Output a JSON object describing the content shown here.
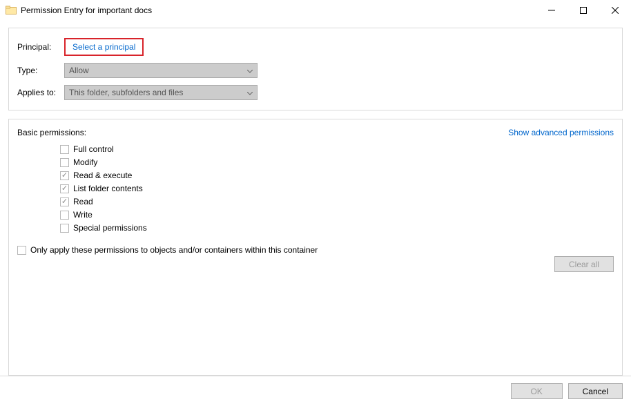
{
  "window": {
    "title": "Permission Entry for important docs"
  },
  "principal": {
    "label": "Principal:",
    "link_text": "Select a principal"
  },
  "type": {
    "label": "Type:",
    "value": "Allow"
  },
  "applies_to": {
    "label": "Applies to:",
    "value": "This folder, subfolders and files"
  },
  "permissions": {
    "title": "Basic permissions:",
    "advanced_link": "Show advanced permissions",
    "items": [
      {
        "label": "Full control",
        "checked": false
      },
      {
        "label": "Modify",
        "checked": false
      },
      {
        "label": "Read & execute",
        "checked": true
      },
      {
        "label": "List folder contents",
        "checked": true
      },
      {
        "label": "Read",
        "checked": true
      },
      {
        "label": "Write",
        "checked": false
      },
      {
        "label": "Special permissions",
        "checked": false
      }
    ],
    "only_apply_label": "Only apply these permissions to objects and/or containers within this container",
    "only_apply_checked": false,
    "clear_all_label": "Clear all"
  },
  "footer": {
    "ok_label": "OK",
    "cancel_label": "Cancel"
  }
}
